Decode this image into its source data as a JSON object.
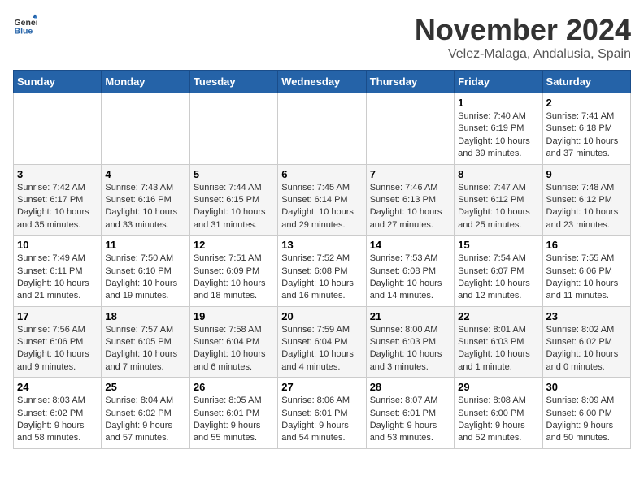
{
  "header": {
    "logo_general": "General",
    "logo_blue": "Blue",
    "title": "November 2024",
    "location": "Velez-Malaga, Andalusia, Spain"
  },
  "calendar": {
    "weekdays": [
      "Sunday",
      "Monday",
      "Tuesday",
      "Wednesday",
      "Thursday",
      "Friday",
      "Saturday"
    ],
    "weeks": [
      [
        {
          "day": "",
          "info": ""
        },
        {
          "day": "",
          "info": ""
        },
        {
          "day": "",
          "info": ""
        },
        {
          "day": "",
          "info": ""
        },
        {
          "day": "",
          "info": ""
        },
        {
          "day": "1",
          "info": "Sunrise: 7:40 AM\nSunset: 6:19 PM\nDaylight: 10 hours and 39 minutes."
        },
        {
          "day": "2",
          "info": "Sunrise: 7:41 AM\nSunset: 6:18 PM\nDaylight: 10 hours and 37 minutes."
        }
      ],
      [
        {
          "day": "3",
          "info": "Sunrise: 7:42 AM\nSunset: 6:17 PM\nDaylight: 10 hours and 35 minutes."
        },
        {
          "day": "4",
          "info": "Sunrise: 7:43 AM\nSunset: 6:16 PM\nDaylight: 10 hours and 33 minutes."
        },
        {
          "day": "5",
          "info": "Sunrise: 7:44 AM\nSunset: 6:15 PM\nDaylight: 10 hours and 31 minutes."
        },
        {
          "day": "6",
          "info": "Sunrise: 7:45 AM\nSunset: 6:14 PM\nDaylight: 10 hours and 29 minutes."
        },
        {
          "day": "7",
          "info": "Sunrise: 7:46 AM\nSunset: 6:13 PM\nDaylight: 10 hours and 27 minutes."
        },
        {
          "day": "8",
          "info": "Sunrise: 7:47 AM\nSunset: 6:12 PM\nDaylight: 10 hours and 25 minutes."
        },
        {
          "day": "9",
          "info": "Sunrise: 7:48 AM\nSunset: 6:12 PM\nDaylight: 10 hours and 23 minutes."
        }
      ],
      [
        {
          "day": "10",
          "info": "Sunrise: 7:49 AM\nSunset: 6:11 PM\nDaylight: 10 hours and 21 minutes."
        },
        {
          "day": "11",
          "info": "Sunrise: 7:50 AM\nSunset: 6:10 PM\nDaylight: 10 hours and 19 minutes."
        },
        {
          "day": "12",
          "info": "Sunrise: 7:51 AM\nSunset: 6:09 PM\nDaylight: 10 hours and 18 minutes."
        },
        {
          "day": "13",
          "info": "Sunrise: 7:52 AM\nSunset: 6:08 PM\nDaylight: 10 hours and 16 minutes."
        },
        {
          "day": "14",
          "info": "Sunrise: 7:53 AM\nSunset: 6:08 PM\nDaylight: 10 hours and 14 minutes."
        },
        {
          "day": "15",
          "info": "Sunrise: 7:54 AM\nSunset: 6:07 PM\nDaylight: 10 hours and 12 minutes."
        },
        {
          "day": "16",
          "info": "Sunrise: 7:55 AM\nSunset: 6:06 PM\nDaylight: 10 hours and 11 minutes."
        }
      ],
      [
        {
          "day": "17",
          "info": "Sunrise: 7:56 AM\nSunset: 6:06 PM\nDaylight: 10 hours and 9 minutes."
        },
        {
          "day": "18",
          "info": "Sunrise: 7:57 AM\nSunset: 6:05 PM\nDaylight: 10 hours and 7 minutes."
        },
        {
          "day": "19",
          "info": "Sunrise: 7:58 AM\nSunset: 6:04 PM\nDaylight: 10 hours and 6 minutes."
        },
        {
          "day": "20",
          "info": "Sunrise: 7:59 AM\nSunset: 6:04 PM\nDaylight: 10 hours and 4 minutes."
        },
        {
          "day": "21",
          "info": "Sunrise: 8:00 AM\nSunset: 6:03 PM\nDaylight: 10 hours and 3 minutes."
        },
        {
          "day": "22",
          "info": "Sunrise: 8:01 AM\nSunset: 6:03 PM\nDaylight: 10 hours and 1 minute."
        },
        {
          "day": "23",
          "info": "Sunrise: 8:02 AM\nSunset: 6:02 PM\nDaylight: 10 hours and 0 minutes."
        }
      ],
      [
        {
          "day": "24",
          "info": "Sunrise: 8:03 AM\nSunset: 6:02 PM\nDaylight: 9 hours and 58 minutes."
        },
        {
          "day": "25",
          "info": "Sunrise: 8:04 AM\nSunset: 6:02 PM\nDaylight: 9 hours and 57 minutes."
        },
        {
          "day": "26",
          "info": "Sunrise: 8:05 AM\nSunset: 6:01 PM\nDaylight: 9 hours and 55 minutes."
        },
        {
          "day": "27",
          "info": "Sunrise: 8:06 AM\nSunset: 6:01 PM\nDaylight: 9 hours and 54 minutes."
        },
        {
          "day": "28",
          "info": "Sunrise: 8:07 AM\nSunset: 6:01 PM\nDaylight: 9 hours and 53 minutes."
        },
        {
          "day": "29",
          "info": "Sunrise: 8:08 AM\nSunset: 6:00 PM\nDaylight: 9 hours and 52 minutes."
        },
        {
          "day": "30",
          "info": "Sunrise: 8:09 AM\nSunset: 6:00 PM\nDaylight: 9 hours and 50 minutes."
        }
      ]
    ]
  }
}
